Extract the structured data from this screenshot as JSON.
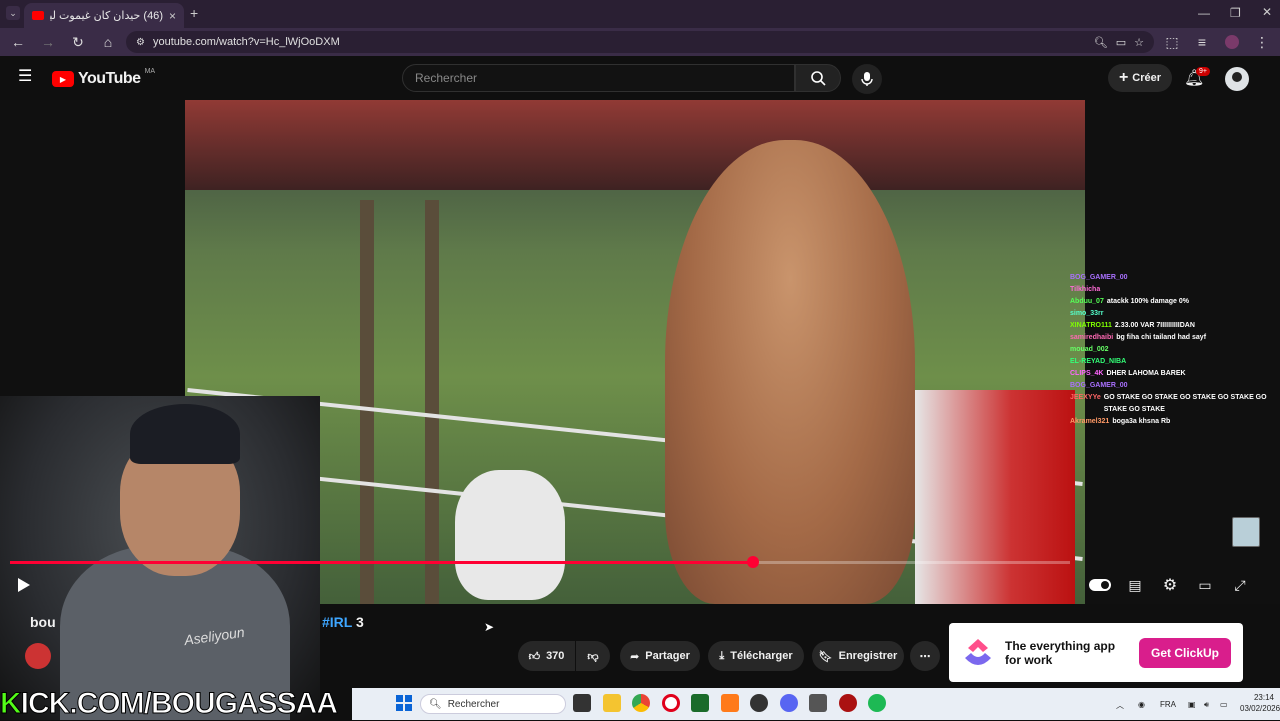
{
  "browser": {
    "tab_title": "(46) حيدان كان غيموت لينا 😱",
    "url": "youtube.com/watch?v=Hc_lWjOoDXM"
  },
  "youtube": {
    "logo": "YouTube",
    "region": "MA",
    "search_placeholder": "Rechercher",
    "create_label": "Créer",
    "notif_count": "9+"
  },
  "video": {
    "progress": 0.701,
    "title_left": "bou",
    "title_hashtag": "#IRL",
    "title_num": "3"
  },
  "chat": [
    {
      "name": "BOG_GAMER_00",
      "color": "#a970ff",
      "msg": ""
    },
    {
      "name": "Tilkhicha",
      "color": "#ff6bd6",
      "msg": ""
    },
    {
      "name": "",
      "color": "#ff4444",
      "msg": ""
    },
    {
      "name": "Abduu_07",
      "color": "#55ff55",
      "msg": "atackk 100% damage 0%"
    },
    {
      "name": "simo_33rr",
      "color": "#55ffcc",
      "msg": ""
    },
    {
      "name": "XINATRO111",
      "color": "#7fff00",
      "msg": "2.33.00 VAR 7IIIIIIIIIIDAN"
    },
    {
      "name": "samiredhaibi",
      "color": "#ff69b4",
      "msg": "bg fiha chi tailand had sayf"
    },
    {
      "name": "mouad_002",
      "color": "#66ff66",
      "msg": ""
    },
    {
      "name": "EL-REYAD_NIBA",
      "color": "#33ff77",
      "msg": ""
    },
    {
      "name": "CLIPS_4K",
      "color": "#ff66ff",
      "msg": "DHER LAHOMA BAREK"
    },
    {
      "name": "BOG_GAMER_00",
      "color": "#a970ff",
      "msg": ""
    },
    {
      "name": "JEEXYYe",
      "color": "#ff6666",
      "msg": "GO STAKE GO STAKE GO STAKE GO STAKE GO STAKE GO STAKE"
    },
    {
      "name": "Akramel321",
      "color": "#ff9966",
      "msg": "boga3a khsna Rb"
    }
  ],
  "actions": {
    "likes": "370",
    "share": "Partager",
    "download": "Télécharger",
    "save": "Enregistrer"
  },
  "ad": {
    "text": "The everything app for work",
    "cta": "Get ClickUp"
  },
  "overlay": {
    "kick_k": "K",
    "kick_rest": "ICK.COM/BOUGASSAA"
  },
  "taskbar": {
    "search_placeholder": "Rechercher",
    "lang": "FRA",
    "time": "23:14",
    "date": "03/02/2026"
  },
  "colors": {
    "accent": "#ff0033",
    "kick_green": "#53fc18"
  }
}
